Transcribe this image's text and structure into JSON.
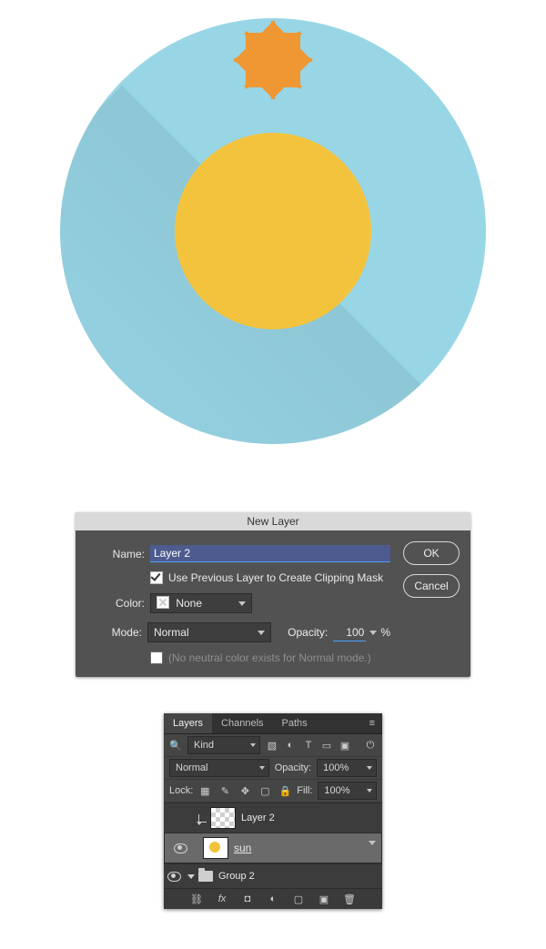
{
  "illustration": {
    "bg": "#98d6e6",
    "core": "#f4c33d",
    "ray": "#ee9733"
  },
  "dialog": {
    "title": "New Layer",
    "name_label": "Name:",
    "name_value": "Layer 2",
    "clip_label": "Use Previous Layer to Create Clipping Mask",
    "clip_checked": true,
    "color_label": "Color:",
    "color_value": "None",
    "mode_label": "Mode:",
    "mode_value": "Normal",
    "opacity_label": "Opacity:",
    "opacity_value": "100",
    "opacity_unit": "%",
    "neutral_label": "(No neutral color exists for Normal mode.)",
    "ok": "OK",
    "cancel": "Cancel"
  },
  "panel": {
    "tabs": [
      "Layers",
      "Channels",
      "Paths"
    ],
    "kind_label": "Kind",
    "blend_value": "Normal",
    "opacity_label": "Opacity:",
    "opacity_value": "100%",
    "lock_label": "Lock:",
    "fill_label": "Fill:",
    "fill_value": "100%",
    "layers": [
      {
        "name": "Layer 2",
        "visible": false,
        "clip": true,
        "thumb": "alpha"
      },
      {
        "name": "sun",
        "visible": true,
        "selected": true,
        "thumb": "sun",
        "underline": true
      },
      {
        "name": "Group 2",
        "visible": true,
        "group": true
      }
    ]
  }
}
